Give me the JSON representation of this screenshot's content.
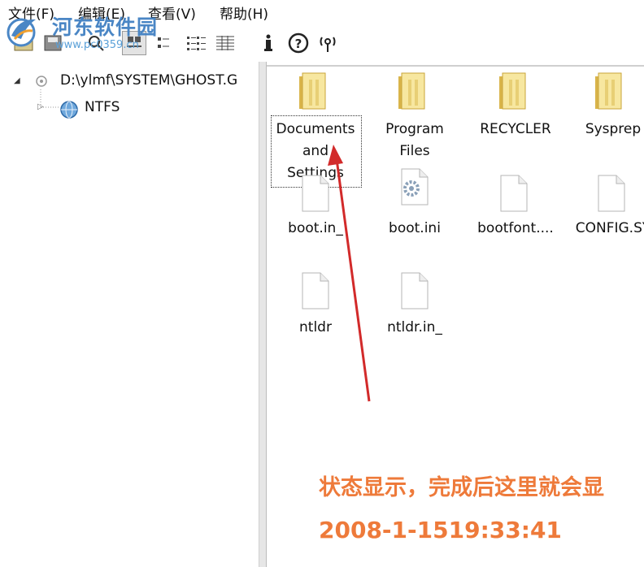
{
  "menu": {
    "items": [
      {
        "label": "文件(F)"
      },
      {
        "label": "编辑(E)"
      },
      {
        "label": "查看(V)"
      },
      {
        "label": "帮助(H)"
      }
    ]
  },
  "watermark": {
    "title": "河东软件园",
    "url": "www.pc0359.cn"
  },
  "toolbar": {
    "buttons": [
      {
        "icon": "open-icon"
      },
      {
        "icon": "disk-icon"
      },
      {
        "icon": "find-icon"
      },
      {
        "icon": "large-icons-view-icon",
        "pressed": true
      },
      {
        "icon": "small-icons-view-icon"
      },
      {
        "icon": "list-view-icon"
      },
      {
        "icon": "details-view-icon"
      },
      {
        "icon": "info-icon"
      },
      {
        "icon": "help-icon"
      },
      {
        "icon": "wireless-icon"
      }
    ]
  },
  "tree": {
    "root": "D:\\ylmf\\SYSTEM\\GHOST.G",
    "child": "NTFS"
  },
  "files": [
    {
      "name_lines": [
        "Documents",
        "and",
        "Settings"
      ],
      "type": "folder",
      "selected": true
    },
    {
      "name_lines": [
        "Program",
        "Files"
      ],
      "type": "folder"
    },
    {
      "name_lines": [
        "RECYCLER"
      ],
      "type": "folder"
    },
    {
      "name_lines": [
        "Sysprep"
      ],
      "type": "folder"
    },
    {
      "name_lines": [
        "boot.in_"
      ],
      "type": "file"
    },
    {
      "name_lines": [
        "boot.ini"
      ],
      "type": "settings-file"
    },
    {
      "name_lines": [
        "bootfont...."
      ],
      "type": "file"
    },
    {
      "name_lines": [
        "CONFIG.SY"
      ],
      "type": "file"
    },
    {
      "name_lines": [
        "ntldr"
      ],
      "type": "file"
    },
    {
      "name_lines": [
        "ntldr.in_"
      ],
      "type": "file"
    }
  ],
  "status": {
    "message": "状态显示，完成后这里就会显",
    "time": "2008-1-1519:33:41"
  },
  "colors": {
    "status_text": "#ee7a3a",
    "annotation_arrow": "#d22a2a",
    "folder_light": "#f7e7a0",
    "folder_dark": "#d9b44a"
  }
}
